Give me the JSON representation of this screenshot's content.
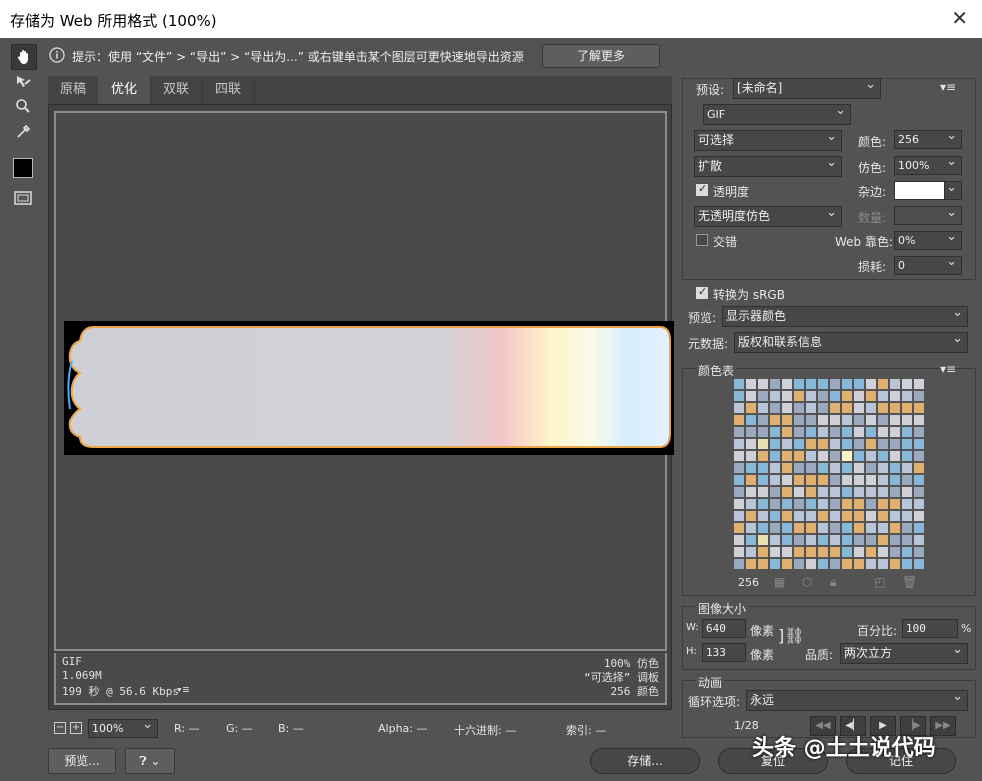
{
  "window": {
    "title": "存储为 Web 所用格式 (100%)",
    "close": "✕"
  },
  "hint": {
    "text": "提示：使用 “文件” > “导出” > “导出为...” 或右键单击某个图层可更快速地导出资源",
    "learn_more": "了解更多"
  },
  "tabs": [
    "原稿",
    "优化",
    "双联",
    "四联"
  ],
  "image_info": {
    "format": "GIF",
    "size": "1.069M",
    "time": "199 秒 @ 56.6 Kbps",
    "dither": "100% 仿色",
    "palette": "“可选择” 调板",
    "colors": "256 颜色"
  },
  "statusbar": {
    "zoom": "100%",
    "r": "R: —",
    "g": "G: —",
    "b": "B: —",
    "alpha": "Alpha: —",
    "hex": "十六进制: —",
    "index": "索引: —"
  },
  "bottom": {
    "preview": "预览...",
    "save": "存储...",
    "reset": "复位",
    "remember": "记住"
  },
  "settings": {
    "preset_label": "预设:",
    "preset_value": "[未命名]",
    "format": "GIF",
    "reduction": "可选择",
    "colors_label": "颜色:",
    "colors_value": "256",
    "dither_algo": "扩散",
    "dither_label": "仿色:",
    "dither_value": "100%",
    "transparency_label": "透明度",
    "transparency_checked": true,
    "matte_label": "杂边:",
    "trans_dither": "无透明度仿色",
    "amount_label": "数量:",
    "interlaced_label": "交错",
    "interlaced_checked": false,
    "web_snap_label": "Web 靠色:",
    "web_snap_value": "0%",
    "lossy_label": "损耗:",
    "lossy_value": "0",
    "convert_srgb_label": "转换为 sRGB",
    "convert_srgb_checked": true,
    "preview_label": "预览:",
    "preview_value": "显示器颜色",
    "metadata_label": "元数据:",
    "metadata_value": "版权和联系信息"
  },
  "color_table": {
    "title": "颜色表",
    "count": "256"
  },
  "image_size": {
    "title": "图像大小",
    "w_label": "W:",
    "w_value": "640",
    "h_label": "H:",
    "h_value": "133",
    "unit": "像素",
    "percent_label": "百分比:",
    "percent_value": "100",
    "percent_unit": "%",
    "quality_label": "品质:",
    "quality_value": "两次立方"
  },
  "animation": {
    "title": "动画",
    "loop_label": "循环选项:",
    "loop_value": "永远",
    "frame": "1/28"
  },
  "watermark": "头条 @土土说代码"
}
